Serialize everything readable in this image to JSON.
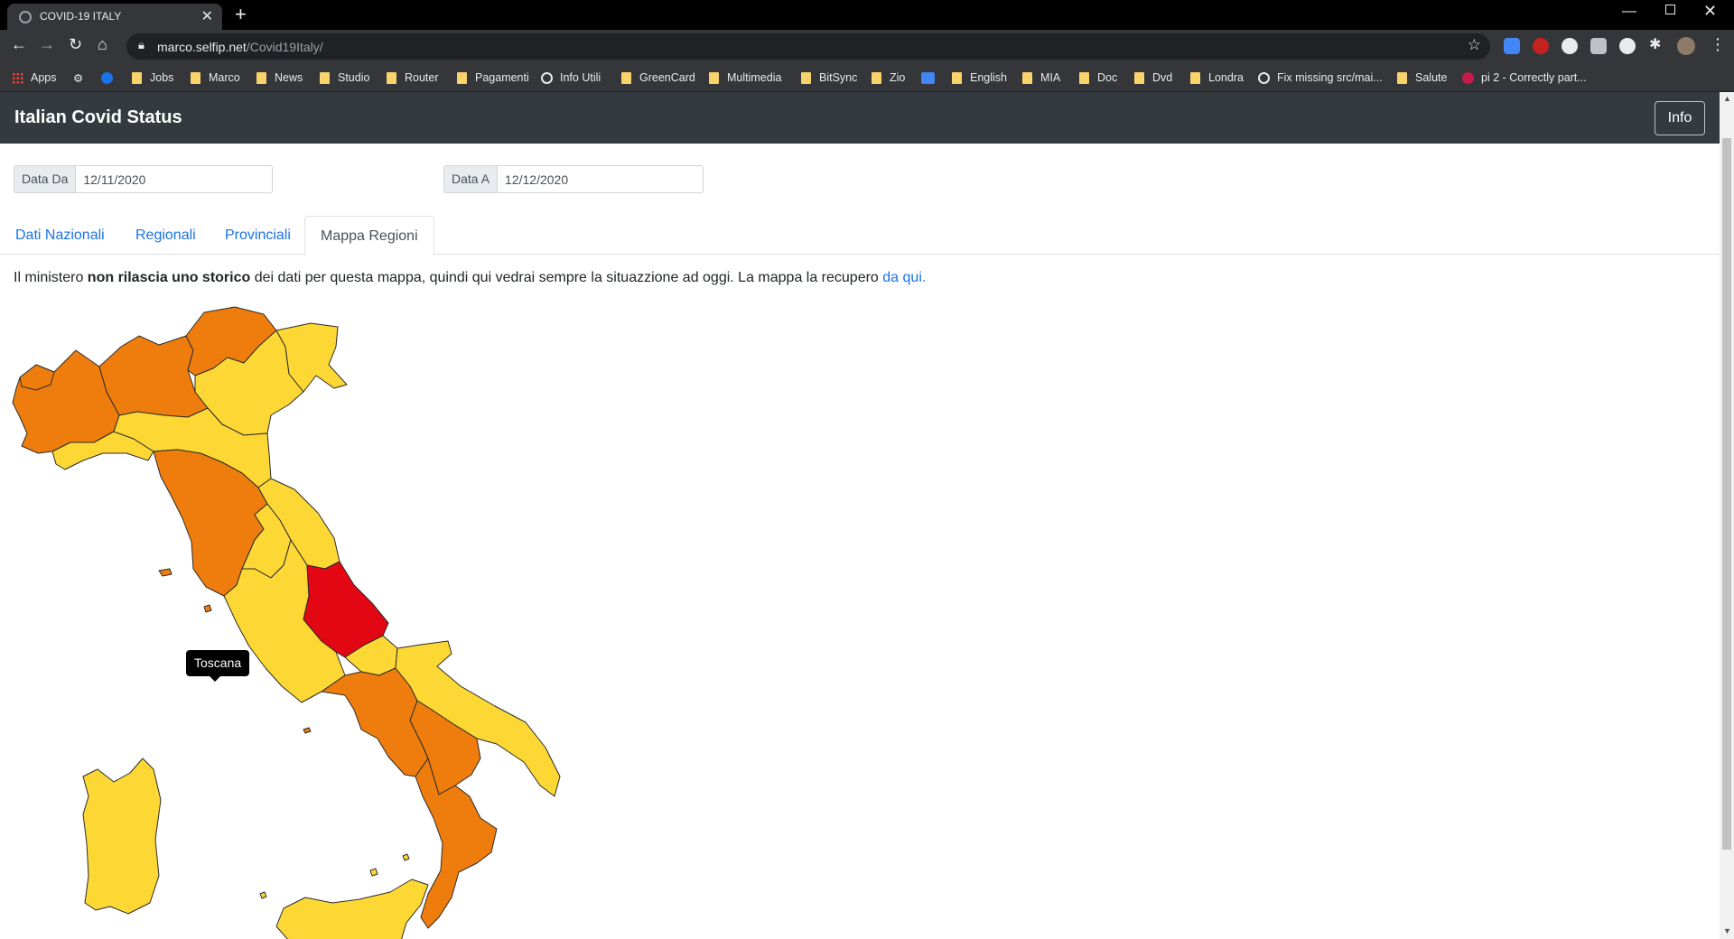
{
  "browser": {
    "tab_title": "COVID-19 ITALY",
    "url_host": "marco.selfip.net",
    "url_path": "/Covid19Italy/",
    "bookmarks": [
      "Apps",
      "Jobs",
      "Marco",
      "News",
      "Studio",
      "Router",
      "Pagamenti",
      "Info Utili",
      "GreenCard",
      "Multimedia",
      "BitSync",
      "Zio",
      "English",
      "MIA",
      "Doc",
      "Dvd",
      "Londra",
      "Fix missing src/mai...",
      "Salute",
      "pi 2 - Correctly part..."
    ]
  },
  "navbar": {
    "brand": "Italian Covid Status",
    "info_label": "Info"
  },
  "filters": {
    "from_label": "Data Da",
    "from_value": "12/11/2020",
    "to_label": "Data A",
    "to_value": "12/12/2020"
  },
  "tabs": [
    "Dati Nazionali",
    "Regionali",
    "Provinciali",
    "Mappa Regioni"
  ],
  "active_tab": "Mappa Regioni",
  "notice": {
    "part1": "Il ministero ",
    "bold": "non rilascia uno storico",
    "part2": " dei dati per questa mappa, quindi qui vedrai sempre la situazzione ad oggi. La mappa la recupero ",
    "link": "da qui."
  },
  "map": {
    "tooltip": "Toscana",
    "colors": {
      "yellow": "#fdd835",
      "orange": "#ef7d0e",
      "red": "#e30613"
    },
    "regions": [
      {
        "name": "Valle d'Aosta",
        "zone": "orange"
      },
      {
        "name": "Piemonte",
        "zone": "orange"
      },
      {
        "name": "Lombardia",
        "zone": "orange"
      },
      {
        "name": "Trentino-Alto Adige",
        "zone": "orange"
      },
      {
        "name": "Veneto",
        "zone": "yellow"
      },
      {
        "name": "Friuli-Venezia Giulia",
        "zone": "yellow"
      },
      {
        "name": "Liguria",
        "zone": "yellow"
      },
      {
        "name": "Emilia-Romagna",
        "zone": "yellow"
      },
      {
        "name": "Toscana",
        "zone": "orange"
      },
      {
        "name": "Umbria",
        "zone": "yellow"
      },
      {
        "name": "Marche",
        "zone": "yellow"
      },
      {
        "name": "Lazio",
        "zone": "yellow"
      },
      {
        "name": "Abruzzo",
        "zone": "red"
      },
      {
        "name": "Molise",
        "zone": "yellow"
      },
      {
        "name": "Campania",
        "zone": "orange"
      },
      {
        "name": "Puglia",
        "zone": "yellow"
      },
      {
        "name": "Basilicata",
        "zone": "orange"
      },
      {
        "name": "Calabria",
        "zone": "orange"
      },
      {
        "name": "Sicilia",
        "zone": "yellow"
      },
      {
        "name": "Sardegna",
        "zone": "yellow"
      }
    ]
  }
}
